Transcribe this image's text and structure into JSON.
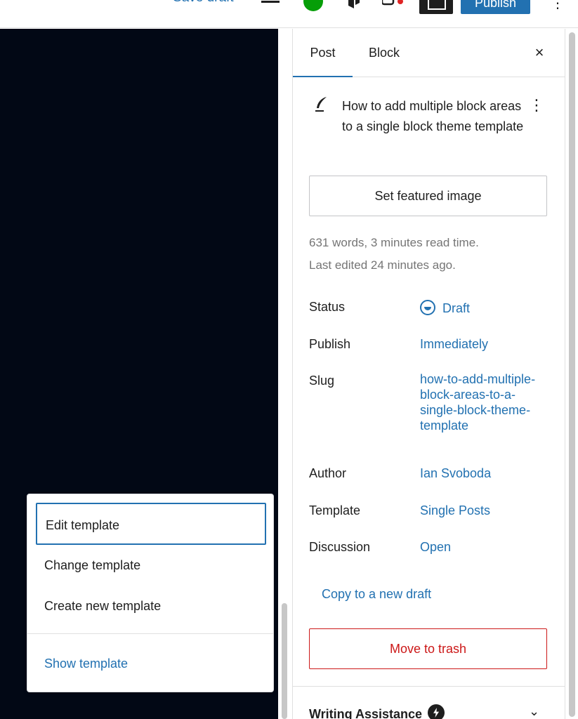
{
  "topbar": {
    "save_draft_label": "Save draft",
    "publish_label": "Publish",
    "more_icon": "⋮"
  },
  "sidebar": {
    "tabs": [
      {
        "label": "Post",
        "active": true
      },
      {
        "label": "Block",
        "active": false
      }
    ],
    "close_icon": "×",
    "post": {
      "title": "How to add multiple block areas to a single block theme template",
      "more_icon": "⋮",
      "featured_image_label": "Set featured image",
      "word_count_text": "631 words, 3 minutes read time.",
      "last_edited_text": "Last edited 24 minutes ago."
    },
    "rows": [
      {
        "label": "Status",
        "value": "Draft"
      },
      {
        "label": "Publish",
        "value": "Immediately"
      },
      {
        "label": "Slug",
        "value": "how-to-add-multiple-block-areas-to-a-single-block-theme-template"
      },
      {
        "label": "Author",
        "value": "Ian Svoboda"
      },
      {
        "label": "Template",
        "value": "Single Posts"
      },
      {
        "label": "Discussion",
        "value": "Open"
      }
    ],
    "copy_draft_label": "Copy to a new draft",
    "trash_label": "Move to trash",
    "writing_assistance_label": "Writing Assistance",
    "writing_chevron": "⌄"
  },
  "template_menu": {
    "items": [
      {
        "label": "Edit template"
      },
      {
        "label": "Change template"
      },
      {
        "label": "Create new template"
      }
    ],
    "show_template_label": "Show template"
  },
  "colors": {
    "accent": "#2271b1",
    "danger": "#cc1818",
    "canvas": "#020815",
    "jetpack": "#069e08"
  }
}
